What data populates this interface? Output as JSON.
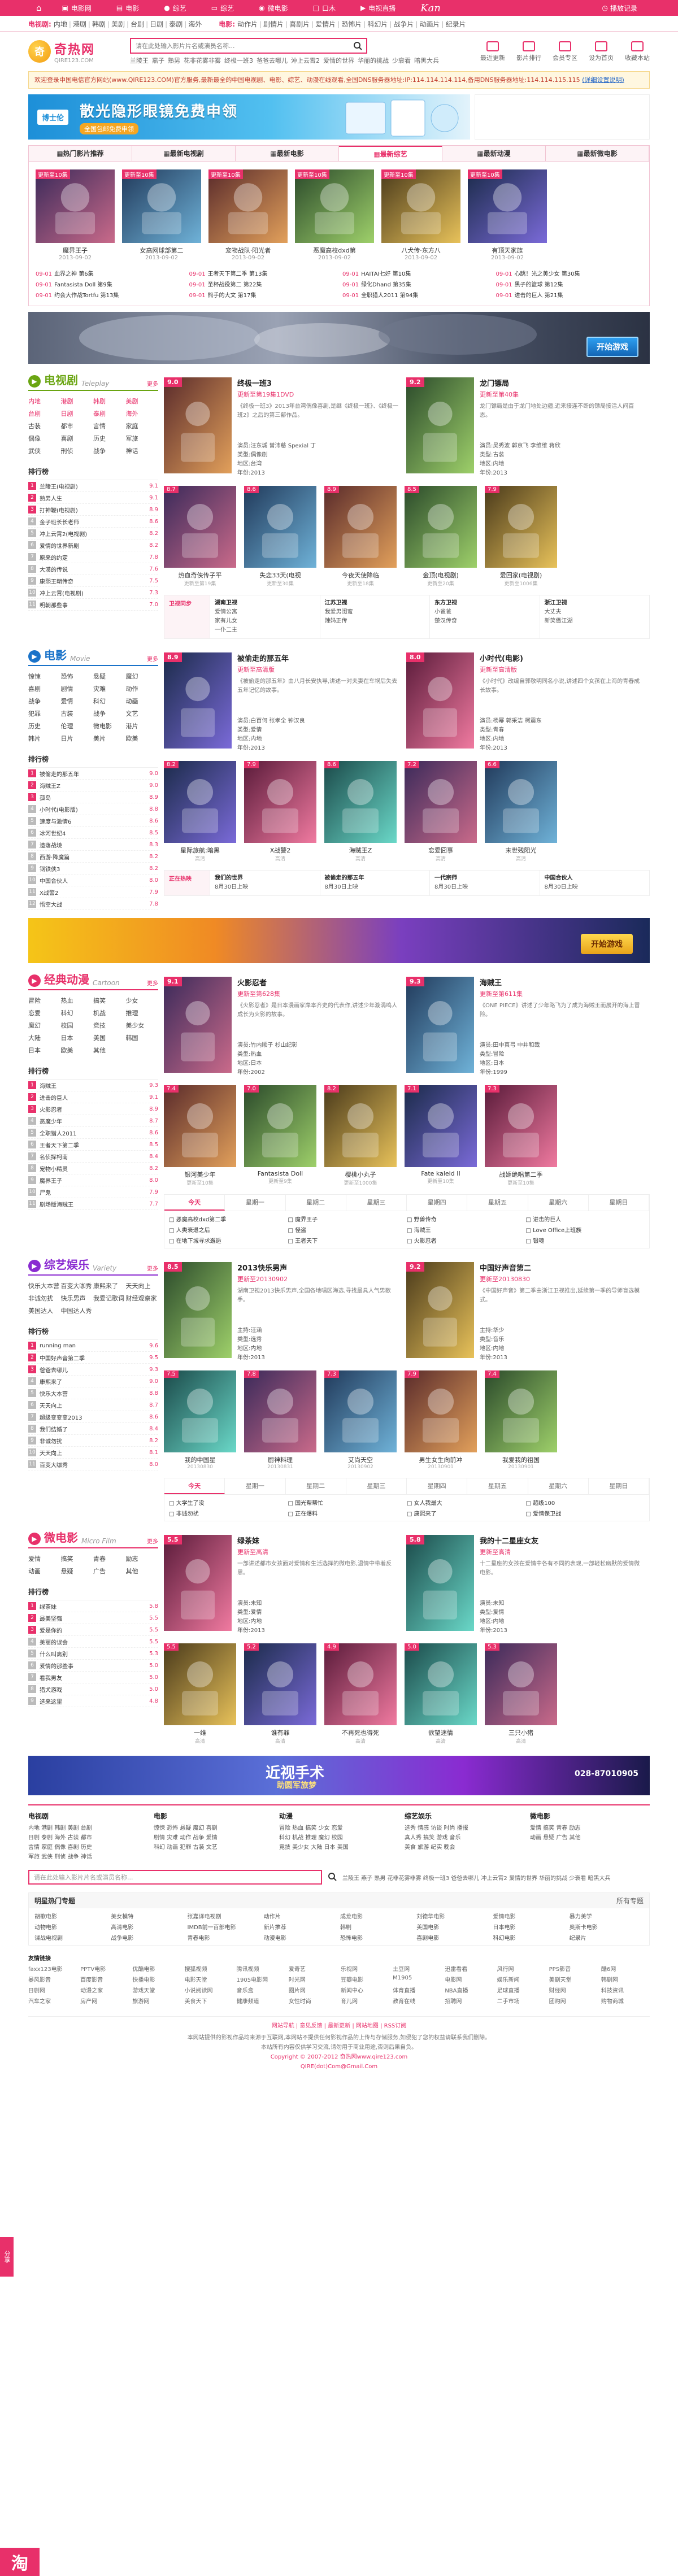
{
  "topbar": {
    "items": [
      {
        "label": "电影网",
        "icon": "film-icon"
      },
      {
        "label": "电影",
        "icon": "clapper-icon"
      },
      {
        "label": "综艺",
        "icon": "mic-icon"
      },
      {
        "label": "综艺",
        "icon": "tv-icon"
      },
      {
        "label": "微电影",
        "icon": "camera-icon"
      },
      {
        "label": "口木",
        "icon": "box-icon"
      },
      {
        "label": "电视直播",
        "icon": "play-icon"
      }
    ],
    "kan": "Kan",
    "login": "播放记录"
  },
  "subnav": {
    "tag1": "电视剧:",
    "links1": [
      "内地",
      "港剧",
      "韩剧",
      "美剧",
      "台剧",
      "日剧",
      "泰剧",
      "海外"
    ],
    "tag2": "电影:",
    "links2": [
      "动作片",
      "剧情片",
      "喜剧片",
      "爱情片",
      "恐怖片",
      "科幻片",
      "战争片",
      "动画片",
      "纪录片"
    ]
  },
  "logo": {
    "name": "奇热网",
    "domain": "QIRE123.COM"
  },
  "search": {
    "placeholder": "请在此处输入影片片名或演员名称...",
    "hot": [
      "兰陵王",
      "燕子",
      "熟男",
      "花非花雾非雾",
      "终极一班3",
      "爸爸去哪儿",
      "沖上云霄2",
      "爱情的世界",
      "华丽的挑战",
      "少衰看",
      "暗黑大兵"
    ]
  },
  "quick": [
    "最近更新",
    "影片排行",
    "会员专区",
    "设为首页",
    "收藏本站"
  ],
  "notice": {
    "text": "欢迎登录中国电信官方网站(www.QIRE123.COM)官方服务,最新最全的中国电视剧、电影、综艺、动漫在线观看,全国DNS服务器地址:IP:114.114.114.114,备用DNS服务器地址:114.114.115.115",
    "link": "(详细设置说明)"
  },
  "banner": {
    "brand": "博士伦",
    "title": "散光隐形眼镜免费申领",
    "sub": "全国包邮免费申领"
  },
  "tabs": [
    "热门影片推荐",
    "最新电视剧",
    "最新电影",
    "最新综艺",
    "最新动漫",
    "最新微电影"
  ],
  "tab_active": 3,
  "posters": [
    {
      "title": "魔界王子",
      "date": "2013-09-02",
      "tag": "更新至10集"
    },
    {
      "title": "女高网球部第二",
      "date": "2013-09-02",
      "tag": "更新至10集"
    },
    {
      "title": "宠物战队·阳光者",
      "date": "2013-09-02",
      "tag": "更新至10集"
    },
    {
      "title": "恶魔高校dxd第",
      "date": "2013-09-02",
      "tag": "更新至10集"
    },
    {
      "title": "八犬传·东方八",
      "date": "2013-09-02",
      "tag": "更新至10集"
    },
    {
      "title": "有顶天家族",
      "date": "2013-09-02",
      "tag": "更新至10集"
    }
  ],
  "updates": [
    {
      "d": "09-01",
      "t": "血界之神 第6集"
    },
    {
      "d": "09-01",
      "t": "王者天下第二季 第13集"
    },
    {
      "d": "09-01",
      "t": "HAITAI七好 第10集"
    },
    {
      "d": "09-01",
      "t": "心跳！光之美少女 第30集"
    },
    {
      "d": "09-01",
      "t": "Fantasista Doll 第9集"
    },
    {
      "d": "09-01",
      "t": "圣杯战役第二 第22集"
    },
    {
      "d": "09-01",
      "t": "绿化Dhand 第35集"
    },
    {
      "d": "09-01",
      "t": "黑子的篮球 第12集"
    },
    {
      "d": "09-01",
      "t": "约会大作战Tortfu 第13集"
    },
    {
      "d": "09-01",
      "t": "熊手的大文 第17集"
    },
    {
      "d": "09-01",
      "t": "全职猎人2011 第94集"
    },
    {
      "d": "09-01",
      "t": "进击的巨人 第21集"
    }
  ],
  "gamead": {
    "button": "开始游戏"
  },
  "sections": [
    {
      "key": "tv",
      "title": "电视剧",
      "en": "Teleplay",
      "color": "#6aa512",
      "more": "更多",
      "cats": [
        "内地",
        "港剧",
        "韩剧",
        "美剧",
        "台剧",
        "日剧",
        "泰剧",
        "海外",
        "古装",
        "都市",
        "言情",
        "家庭",
        "偶像",
        "喜剧",
        "历史",
        "军旅",
        "武侠",
        "刑侦",
        "战争",
        "神话"
      ],
      "rank_title": "排行榜",
      "rank": [
        [
          "兰陵王(电视剧)",
          "9.1"
        ],
        [
          "熟男人生",
          "9.1"
        ],
        [
          "打神鞭(电视剧)",
          "8.9"
        ],
        [
          "金子班长长老师",
          "8.6"
        ],
        [
          "冲上云霄2(电视剧)",
          "8.2"
        ],
        [
          "爱情的世界新剧",
          "8.2"
        ],
        [
          "原来的约定",
          "7.8"
        ],
        [
          "大漠的传说",
          "7.6"
        ],
        [
          "康熙王朝传奇",
          "7.5"
        ],
        [
          "冲上云霄(电视剧)",
          "7.3"
        ],
        [
          "明朝那些事",
          "7.0"
        ]
      ],
      "features": [
        {
          "title": "终极一班3",
          "sub": "更新至第19集1DVD",
          "score": "9.0",
          "desc": "《终极一班3》2013年台湾偶像喜剧,是继《终极一班》、《终极一班2》之后的第三部作品。",
          "meta": [
            "演员:汪东城 曾沛慈 Spexial 丁",
            "类型:偶像剧",
            "地区:台湾",
            "年份:2013"
          ]
        },
        {
          "title": "龙门镖局",
          "sub": "更新至第40集",
          "score": "9.2",
          "desc": "龙门镖局是由于龙门地处边疆,近来接连不断的镖局接活人间百态。",
          "meta": [
            "演员:吴秀波 郭京飞 李维维 蒋欣",
            "类型:古装",
            "地区:内地",
            "年份:2013"
          ]
        }
      ],
      "cards": [
        {
          "name": "热血奇侠传子平",
          "sub": "更新至第19集",
          "s": "8.7"
        },
        {
          "name": "失恋33天(电视",
          "sub": "更新至30集",
          "s": "8.6"
        },
        {
          "name": "今夜天使降临",
          "sub": "更新至18集",
          "s": "8.9"
        },
        {
          "name": "金顶(电视剧)",
          "sub": "更新至20集",
          "s": "8.5"
        },
        {
          "name": "爱回家(电视剧)",
          "sub": "更新至1006集",
          "s": "7.9"
        }
      ],
      "sched": [
        {
          "h": "卫视同步",
          "cols": [
            [
              "湖南卫视",
              "爱情公寓",
              "家有儿女",
              "一仆二主"
            ],
            [
              "江苏卫视",
              "我爱男闺蜜",
              "辣妈正传"
            ],
            [
              "东方卫视",
              "小爸爸",
              "楚汉传奇"
            ],
            [
              "浙江卫视",
              "大丈夫",
              "新笑傲江湖"
            ]
          ]
        }
      ]
    },
    {
      "key": "movie",
      "title": "电影",
      "en": "Movie",
      "color": "#1a73c9",
      "more": "更多",
      "cats": [
        "惊悚",
        "恐怖",
        "悬疑",
        "魔幻",
        "喜剧",
        "剧情",
        "灾难",
        "动作",
        "战争",
        "爱情",
        "科幻",
        "动画",
        "犯罪",
        "古装",
        "战争",
        "文艺",
        "历史",
        "伦理",
        "微电影",
        "港片",
        "韩片",
        "日片",
        "美片",
        "欧美"
      ],
      "rank_title": "排行榜",
      "rank": [
        [
          "被偷走的那五年",
          "9.0"
        ],
        [
          "海贼王Z",
          "9.0"
        ],
        [
          "孤岛",
          "8.9"
        ],
        [
          "小时代(电影版)",
          "8.8"
        ],
        [
          "速度与激情6",
          "8.6"
        ],
        [
          "冰河世纪4",
          "8.5"
        ],
        [
          "遗落战境",
          "8.3"
        ],
        [
          "西游·降魔篇",
          "8.2"
        ],
        [
          "钢铁侠3",
          "8.2"
        ],
        [
          "中国合伙人",
          "8.0"
        ],
        [
          "X战警2",
          "7.9"
        ],
        [
          "悟空大战",
          "7.8"
        ]
      ],
      "features": [
        {
          "title": "被偷走的那五年",
          "sub": "更新至高清版",
          "score": "8.9",
          "desc": "《被偷走的那五年》由八月长安执导,讲述一对夫妻在车祸后失去五年记忆的故事。",
          "meta": [
            "演员:白百何 张孝全 钟汉良",
            "类型:爱情",
            "地区:内地",
            "年份:2013"
          ]
        },
        {
          "title": "小时代(电影)",
          "sub": "更新至高清版",
          "score": "8.0",
          "desc": "《小时代》改编自郭敬明同名小说,讲述四个女孩在上海的青春成长故事。",
          "meta": [
            "演员:杨幂 郭采洁 柯震东",
            "类型:青春",
            "地区:内地",
            "年份:2013"
          ]
        }
      ],
      "cards": [
        {
          "name": "星际旅航:暗黑",
          "sub": "高清",
          "s": "8.2"
        },
        {
          "name": "X战警2",
          "sub": "高清",
          "s": "7.9"
        },
        {
          "name": "海贼王Z",
          "sub": "高清",
          "s": "8.6"
        },
        {
          "name": "恋爱囧事",
          "sub": "高清",
          "s": "7.2"
        },
        {
          "name": "末世残阳光",
          "sub": "高清",
          "s": "6.6"
        }
      ],
      "sched": [
        {
          "h": "正在热映",
          "cols": [
            [
              "我们的世界",
              "8月30日上映"
            ],
            [
              "被偷走的那五年",
              "8月30日上映"
            ],
            [
              "一代宗师",
              "8月30日上映"
            ],
            [
              "中国合伙人",
              "8月30日上映"
            ]
          ]
        }
      ]
    },
    {
      "key": "anime",
      "title": "经典动漫",
      "en": "Cartoon",
      "color": "#e8306a",
      "more": "更多",
      "cats": [
        "冒险",
        "热血",
        "搞笑",
        "少女",
        "恋爱",
        "科幻",
        "机战",
        "推理",
        "魔幻",
        "校园",
        "竞技",
        "美少女",
        "大陆",
        "日本",
        "美国",
        "韩国",
        "日本",
        "欧美",
        "其他"
      ],
      "rank_title": "排行榜",
      "rank": [
        [
          "海贼王",
          "9.3"
        ],
        [
          "进击的巨人",
          "9.1"
        ],
        [
          "火影忍者",
          "8.9"
        ],
        [
          "恶魔少年",
          "8.7"
        ],
        [
          "全职猎人2011",
          "8.6"
        ],
        [
          "王者天下第二季",
          "8.5"
        ],
        [
          "名侦探柯南",
          "8.4"
        ],
        [
          "宠物小精灵",
          "8.2"
        ],
        [
          "魔界王子",
          "8.0"
        ],
        [
          "尸鬼",
          "7.9"
        ],
        [
          "剧场版海贼王",
          "7.7"
        ]
      ],
      "features": [
        {
          "title": "火影忍者",
          "sub": "更新至第628集",
          "score": "9.1",
          "desc": "《火影忍者》是日本漫画家岸本齐史的代表作,讲述少年漩涡鸣人成长为火影的故事。",
          "meta": [
            "演员:竹内顺子 杉山纪彰",
            "类型:热血",
            "地区:日本",
            "年份:2002"
          ]
        },
        {
          "title": "海贼王",
          "sub": "更新至第611集",
          "score": "9.3",
          "desc": "《ONE PIECE》讲述了少年路飞为了成为海贼王而展开的海上冒险。",
          "meta": [
            "演员:田中真弓 中井和哉",
            "类型:冒险",
            "地区:日本",
            "年份:1999"
          ]
        }
      ],
      "cards": [
        {
          "name": "银河美少年",
          "sub": "更新至10集",
          "s": "7.4"
        },
        {
          "name": "Fantasista Doll",
          "sub": "更新至9集",
          "s": "7.0"
        },
        {
          "name": "樱桃小丸子",
          "sub": "更新至1000集",
          "s": "8.2"
        },
        {
          "name": "Fate kaleid II",
          "sub": "更新至10集",
          "s": "7.1"
        },
        {
          "name": "战姬绝唱第二季",
          "sub": "更新至10集",
          "s": "7.3"
        }
      ],
      "week": [
        "今天",
        "星期一",
        "星期二",
        "星期三",
        "星期四",
        "星期五",
        "星期六",
        "星期日"
      ],
      "weekitems": [
        "恶魔高校dxd第二季",
        "魔界王子",
        "野兽传奇",
        "进击的巨人",
        "人类衰退之后",
        "怪盗",
        "海贼王",
        "Love Office上班族",
        "在地下城寻求邂逅",
        "王者天下",
        "火影忍者",
        "银魂"
      ]
    },
    {
      "key": "variety",
      "title": "综艺娱乐",
      "en": "Variety",
      "color": "#8a2bd1",
      "more": "更多",
      "cats": [
        "快乐大本营",
        "百变大咖秀",
        "康熙来了",
        "天天向上",
        "非诚勿扰",
        "快乐男声",
        "我爱记歌词",
        "财经观察家",
        "美国达人",
        "中国达人秀"
      ],
      "rank_title": "排行榜",
      "rank": [
        [
          "running man",
          "9.6"
        ],
        [
          "中国好声音第二季",
          "9.5"
        ],
        [
          "爸爸去哪儿",
          "9.3"
        ],
        [
          "康熙来了",
          "9.0"
        ],
        [
          "快乐大本营",
          "8.8"
        ],
        [
          "天天向上",
          "8.7"
        ],
        [
          "超级变变变2013",
          "8.6"
        ],
        [
          "我们结婚了",
          "8.4"
        ],
        [
          "非诚勿扰",
          "8.2"
        ],
        [
          "天天向上",
          "8.1"
        ],
        [
          "百变大咖秀",
          "8.0"
        ]
      ],
      "features": [
        {
          "title": "2013快乐男声",
          "sub": "更新至20130902",
          "score": "8.5",
          "desc": "湖南卫视2013快乐男声,全国各地唱区海选,寻找最具人气男歌手。",
          "meta": [
            "主持:汪涵",
            "类型:选秀",
            "地区:内地",
            "年份:2013"
          ]
        },
        {
          "title": "中国好声音第二",
          "sub": "更新至20130830",
          "score": "9.2",
          "desc": "《中国好声音》第二季由浙江卫视推出,延续第一季的导师盲选模式。",
          "meta": [
            "主持:华少",
            "类型:音乐",
            "地区:内地",
            "年份:2013"
          ]
        }
      ],
      "cards": [
        {
          "name": "我的中国星",
          "sub": "20130830",
          "s": "7.5"
        },
        {
          "name": "厨神料理",
          "sub": "20130831",
          "s": "7.8"
        },
        {
          "name": "艾尚天空",
          "sub": "20130902",
          "s": "7.3"
        },
        {
          "name": "男生女生向前冲",
          "sub": "20130901",
          "s": "7.9"
        },
        {
          "name": "我爱我的祖国",
          "sub": "20130901",
          "s": "7.4"
        }
      ],
      "week": [
        "今天",
        "星期一",
        "星期二",
        "星期三",
        "星期四",
        "星期五",
        "星期六",
        "星期日"
      ],
      "weekitems": [
        "大学生了没",
        "国光帮帮忙",
        "女人我最大",
        "超级100",
        "非诚勿扰",
        "正在爆料",
        "康熙来了",
        "爱情保卫战"
      ]
    },
    {
      "key": "micro",
      "title": "微电影",
      "en": "Micro Film",
      "color": "#e8306a",
      "more": "更多",
      "cats": [
        "爱情",
        "搞笑",
        "青春",
        "励志",
        "动画",
        "悬疑",
        "广告",
        "其他"
      ],
      "rank_title": "排行榜",
      "rank": [
        [
          "绿茶妹",
          "5.8"
        ],
        [
          "最美坚强",
          "5.5"
        ],
        [
          "爱是你的",
          "5.5"
        ],
        [
          "美丽的误会",
          "5.5"
        ],
        [
          "什么叫离别",
          "5.3"
        ],
        [
          "爱情的那些事",
          "5.0"
        ],
        [
          "看我男友",
          "5.0"
        ],
        [
          "猎犬游戏",
          "5.0"
        ],
        [
          "选来这里",
          "4.8"
        ]
      ],
      "features": [
        {
          "title": "绿茶妹",
          "sub": "更新至高清",
          "score": "5.5",
          "desc": "一部讲述都市女孩面对爱情和生活选择的微电影,温情中带着反思。",
          "meta": [
            "演员:未知",
            "类型:爱情",
            "地区:内地",
            "年份:2013"
          ]
        },
        {
          "title": "我的十二星座女友",
          "sub": "更新至高清",
          "score": "5.8",
          "desc": "十二星座的女孩在爱情中各有不同的表现,一部轻松幽默的爱情微电影。",
          "meta": [
            "演员:未知",
            "类型:爱情",
            "地区:内地",
            "年份:2013"
          ]
        }
      ],
      "cards": [
        {
          "name": "一维",
          "sub": "高清",
          "s": "5.5"
        },
        {
          "name": "谁有罪",
          "sub": "高清",
          "s": "5.2"
        },
        {
          "name": "不再死也得死",
          "sub": "高清",
          "s": "4.9"
        },
        {
          "name": "欲望迷情",
          "sub": "高清",
          "s": "5.0"
        },
        {
          "name": "三只小猪",
          "sub": "高清",
          "s": "5.3"
        }
      ]
    }
  ],
  "midad": {
    "button": "开始游戏"
  },
  "bottomad": {
    "title": "近视手术",
    "sub": "助圆军旅梦",
    "phone": "028-87010905"
  },
  "fcats": [
    {
      "h": "电视剧",
      "l": [
        "内地 港剧 韩剧 美剧 台剧",
        "日剧 泰剧 海外 古装 都市",
        "言情 家庭 偶像 喜剧 历史",
        "军旅 武侠 刑侦 战争 神话"
      ]
    },
    {
      "h": "电影",
      "l": [
        "惊悚 恐怖 悬疑 魔幻 喜剧",
        "剧情 灾难 动作 战争 爱情",
        "科幻 动画 犯罪 古装 文艺"
      ]
    },
    {
      "h": "动漫",
      "l": [
        "冒险 热血 搞笑 少女 恋爱",
        "科幻 机战 推理 魔幻 校园",
        "竞技 美少女 大陆 日本 美国"
      ]
    },
    {
      "h": "综艺娱乐",
      "l": [
        "选秀 情感 访谈 时尚 播报",
        "真人秀 搞笑 游戏 音乐",
        "美食 旅游 纪实 晚会"
      ]
    },
    {
      "h": "微电影",
      "l": [
        "爱情 搞笑 青春 励志",
        "动画 悬疑 广告 其他"
      ]
    }
  ],
  "fsearch": {
    "placeholder": "请在此处输入影片片名或演员名称...",
    "hot": "兰陵王 燕子 熟男 花非花雾非雾 终极一班3 爸爸去哪儿 冲上云霄2 爱情的世界 华丽的挑战 少衰看 暗黑大兵"
  },
  "frec": {
    "title": "明星热门专题",
    "more": "所有专题",
    "items": [
      "胡歌电影",
      "美女模特",
      "张嘉译电视剧",
      "动作片",
      "成龙电影",
      "刘德华电影",
      "爱情电影",
      "暴力美学",
      "动物电影",
      "高清电影",
      "IMDB前一百部电影",
      "新片推荐",
      "韩剧",
      "美国电影",
      "日本电影",
      "奥斯卡电影",
      "谍战电视剧",
      "战争电影",
      "青春电影",
      "动漫电影",
      "恐怖电影",
      "喜剧电影",
      "科幻电影",
      "纪录片"
    ]
  },
  "links": {
    "title": "友情链接",
    "items": [
      "faxx123电影",
      "PPTV电影",
      "优酷电影",
      "搜狐视频",
      "腾讯视频",
      "爱奇艺",
      "乐视网",
      "土豆网",
      "迅雷看看",
      "风行网",
      "PPS影音",
      "酷6网",
      "暴风影音",
      "百度影音",
      "快播电影",
      "电影天堂",
      "1905电影网",
      "时光网",
      "豆瓣电影",
      "M1905",
      "电影网",
      "娱乐新闻",
      "美剧天堂",
      "韩剧网",
      "日剧网",
      "动漫之家",
      "游戏天堂",
      "小说阅读网",
      "音乐盒",
      "图片网",
      "新闻中心",
      "体育直播",
      "NBA直播",
      "足球直播",
      "财经网",
      "科技资讯",
      "汽车之家",
      "房产网",
      "旅游网",
      "美食天下",
      "健康频道",
      "女性时尚",
      "育儿网",
      "教育在线",
      "招聘网",
      "二手市场",
      "团购网",
      "购物商城"
    ]
  },
  "foot": {
    "nav": "网站导航 | 意见反馈 | 最新更新 | 网站地图 | RSS订阅",
    "line1": "本网站提供的影视作品均来源于互联网,本网站不提供任何影视作品的上传与存储服务,如侵犯了您的权益请联系我们删除。",
    "line2": "本站所有内容仅供学习交流,请勿用于商业用途,否则后果自负。",
    "copy": "Copyright © 2007-2012 奇热网www.qire123.com",
    "mail": "QIRE(dot)Com@Gmail.Com"
  },
  "side": {
    "left": "分享",
    "taobao": "淘"
  }
}
